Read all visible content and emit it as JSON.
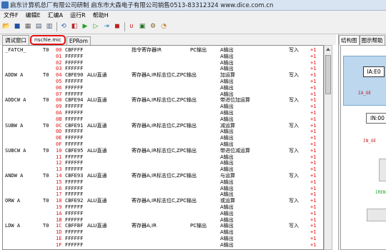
{
  "window": {
    "title": "启东计算机总厂有限公司研制  启东市大森电子有限公司销售0513-83312324 www.dice.com.cn"
  },
  "menu": [
    "文件F",
    "编辑E",
    "汇编A",
    "运行R",
    "帮助H"
  ],
  "toolbar": {
    "buttons": [
      {
        "name": "open-icon",
        "glyph": "📂",
        "color": "#c8a000"
      },
      {
        "name": "save-icon",
        "glyph": "■",
        "color": "#2050a0"
      },
      {
        "name": "compile-icon",
        "glyph": "▦",
        "color": "#606060"
      },
      {
        "name": "download-icon",
        "glyph": "▤",
        "color": "#506080"
      },
      {
        "name": "upload-icon",
        "glyph": "▥",
        "color": "#506080"
      },
      {
        "name": "reset-icon",
        "glyph": "⟲",
        "color": "#3060c0"
      },
      {
        "name": "step-back-icon",
        "glyph": "◧",
        "color": "#c02020"
      },
      {
        "name": "run-icon",
        "glyph": "▶",
        "color": "#20a020"
      },
      {
        "name": "step-icon",
        "glyph": "▷",
        "color": "#20a020"
      },
      {
        "name": "micro-step-icon",
        "glyph": "⇥",
        "color": "#2080c0"
      },
      {
        "name": "stop-icon",
        "glyph": "◼",
        "color": "#c02020"
      },
      {
        "name": "u-icon",
        "glyph": "υ",
        "color": "#c02020"
      },
      {
        "name": "table-icon",
        "glyph": "▣",
        "color": "#207020"
      },
      {
        "name": "settings-icon",
        "glyph": "⚙",
        "color": "#806020"
      },
      {
        "name": "help-icon",
        "glyph": "◔",
        "color": "#c08020"
      }
    ]
  },
  "tabs": [
    "调试窗口",
    "rischle.mic",
    "EPRom"
  ],
  "right_tabs": [
    "结构图",
    "图示帮助"
  ],
  "diagram": {
    "ia_label": "IA:E0",
    "ia_signal": "IA_OE",
    "in_label": "IN:00",
    "in_signal": "IN_OE",
    "bus_signal": "IREN"
  },
  "listing": [
    {
      "label": "_FATCH_",
      "t0": "T0",
      "addr": "00",
      "code": "CBFFFF",
      "desc": "",
      "regs": "指令寄存器IR",
      "extra": "PC输出",
      "a": "A输出",
      "wr": "写入",
      "plus": "+1"
    },
    {
      "label": "",
      "t0": "",
      "addr": "01",
      "code": "FFFFFF",
      "desc": "",
      "regs": "",
      "extra": "",
      "a": "A输出",
      "wr": "",
      "plus": "+1"
    },
    {
      "label": "",
      "t0": "",
      "addr": "02",
      "code": "FFFFFF",
      "desc": "",
      "regs": "",
      "extra": "",
      "a": "A输出",
      "wr": "",
      "plus": "+1"
    },
    {
      "label": "",
      "t0": "",
      "addr": "03",
      "code": "FFFFFF",
      "desc": "",
      "regs": "",
      "extra": "",
      "a": "A输出",
      "wr": "",
      "plus": "+1"
    },
    {
      "label": "ADDW A",
      "t0": "T0",
      "addr": "04",
      "code": "CBFE90",
      "desc": "ALU直通",
      "regs": "寄存器A,IR标志位C,ZPC输出",
      "extra": "",
      "a": "加运算",
      "wr": "写入",
      "plus": "+1"
    },
    {
      "label": "",
      "t0": "",
      "addr": "05",
      "code": "FFFFFF",
      "desc": "",
      "regs": "",
      "extra": "",
      "a": "A输出",
      "wr": "",
      "plus": "+1"
    },
    {
      "label": "",
      "t0": "",
      "addr": "06",
      "code": "FFFFFF",
      "desc": "",
      "regs": "",
      "extra": "",
      "a": "A输出",
      "wr": "",
      "plus": "+1"
    },
    {
      "label": "",
      "t0": "",
      "addr": "07",
      "code": "FFFFFF",
      "desc": "",
      "regs": "",
      "extra": "",
      "a": "A输出",
      "wr": "",
      "plus": "+1"
    },
    {
      "label": "ADDCW A",
      "t0": "T0",
      "addr": "08",
      "code": "CBFE94",
      "desc": "ALU直通",
      "regs": "寄存器A,IR标志位C,ZPC输出",
      "extra": "",
      "a": "带进位加运算",
      "wr": "写入",
      "plus": "+1"
    },
    {
      "label": "",
      "t0": "",
      "addr": "09",
      "code": "FFFFFF",
      "desc": "",
      "regs": "",
      "extra": "",
      "a": "A输出",
      "wr": "",
      "plus": "+1"
    },
    {
      "label": "",
      "t0": "",
      "addr": "0A",
      "code": "FFFFFF",
      "desc": "",
      "regs": "",
      "extra": "",
      "a": "A输出",
      "wr": "",
      "plus": "+1"
    },
    {
      "label": "",
      "t0": "",
      "addr": "0B",
      "code": "FFFFFF",
      "desc": "",
      "regs": "",
      "extra": "",
      "a": "A输出",
      "wr": "",
      "plus": "+1"
    },
    {
      "label": "SUBW A",
      "t0": "T0",
      "addr": "0C",
      "code": "CBFE91",
      "desc": "ALU直通",
      "regs": "寄存器A,IR标志位C,ZPC输出",
      "extra": "",
      "a": "减运算",
      "wr": "写入",
      "plus": "+1"
    },
    {
      "label": "",
      "t0": "",
      "addr": "0D",
      "code": "FFFFFF",
      "desc": "",
      "regs": "",
      "extra": "",
      "a": "A输出",
      "wr": "",
      "plus": "+1"
    },
    {
      "label": "",
      "t0": "",
      "addr": "0E",
      "code": "FFFFFF",
      "desc": "",
      "regs": "",
      "extra": "",
      "a": "A输出",
      "wr": "",
      "plus": "+1"
    },
    {
      "label": "",
      "t0": "",
      "addr": "0F",
      "code": "FFFFFF",
      "desc": "",
      "regs": "",
      "extra": "",
      "a": "A输出",
      "wr": "",
      "plus": "+1"
    },
    {
      "label": "SUBCW A",
      "t0": "T0",
      "addr": "10",
      "code": "CBFE95",
      "desc": "ALU直通",
      "regs": "寄存器A,IR标志位C,ZPC输出",
      "extra": "",
      "a": "带进位减运算",
      "wr": "写入",
      "plus": "+1"
    },
    {
      "label": "",
      "t0": "",
      "addr": "11",
      "code": "FFFFFF",
      "desc": "",
      "regs": "",
      "extra": "",
      "a": "A输出",
      "wr": "",
      "plus": "+1"
    },
    {
      "label": "",
      "t0": "",
      "addr": "12",
      "code": "FFFFFF",
      "desc": "",
      "regs": "",
      "extra": "",
      "a": "A输出",
      "wr": "",
      "plus": "+1"
    },
    {
      "label": "",
      "t0": "",
      "addr": "13",
      "code": "FFFFFF",
      "desc": "",
      "regs": "",
      "extra": "",
      "a": "A输出",
      "wr": "",
      "plus": "+1"
    },
    {
      "label": "ANDW A",
      "t0": "T0",
      "addr": "14",
      "code": "CBFE93",
      "desc": "ALU直通",
      "regs": "寄存器A,IR标志位C,ZPC输出",
      "extra": "",
      "a": "与运算",
      "wr": "写入",
      "plus": "+1"
    },
    {
      "label": "",
      "t0": "",
      "addr": "15",
      "code": "FFFFFF",
      "desc": "",
      "regs": "",
      "extra": "",
      "a": "A输出",
      "wr": "",
      "plus": "+1"
    },
    {
      "label": "",
      "t0": "",
      "addr": "16",
      "code": "FFFFFF",
      "desc": "",
      "regs": "",
      "extra": "",
      "a": "A输出",
      "wr": "",
      "plus": "+1"
    },
    {
      "label": "",
      "t0": "",
      "addr": "17",
      "code": "FFFFFF",
      "desc": "",
      "regs": "",
      "extra": "",
      "a": "A输出",
      "wr": "",
      "plus": "+1"
    },
    {
      "label": "ORW A",
      "t0": "T0",
      "addr": "18",
      "code": "CBFE92",
      "desc": "ALU直通",
      "regs": "寄存器A,IR标志位C,ZPC输出",
      "extra": "",
      "a": "或运算",
      "wr": "写入",
      "plus": "+1"
    },
    {
      "label": "",
      "t0": "",
      "addr": "19",
      "code": "FFFFFF",
      "desc": "",
      "regs": "",
      "extra": "",
      "a": "A输出",
      "wr": "",
      "plus": "+1"
    },
    {
      "label": "",
      "t0": "",
      "addr": "1A",
      "code": "FFFFFF",
      "desc": "",
      "regs": "",
      "extra": "",
      "a": "A输出",
      "wr": "",
      "plus": "+1"
    },
    {
      "label": "",
      "t0": "",
      "addr": "1B",
      "code": "FFFFFF",
      "desc": "",
      "regs": "",
      "extra": "",
      "a": "A输出",
      "wr": "",
      "plus": "+1"
    },
    {
      "label": "LDW A",
      "t0": "T0",
      "addr": "1C",
      "code": "CBFFBF",
      "desc": "ALU直通",
      "regs": "寄存器A,IR",
      "extra": "PC输出",
      "a": "A输出",
      "wr": "写入",
      "plus": "+1"
    },
    {
      "label": "",
      "t0": "",
      "addr": "1D",
      "code": "FFFFFF",
      "desc": "",
      "regs": "",
      "extra": "",
      "a": "A输出",
      "wr": "",
      "plus": "+1"
    },
    {
      "label": "",
      "t0": "",
      "addr": "1E",
      "code": "FFFFFF",
      "desc": "",
      "regs": "",
      "extra": "",
      "a": "A输出",
      "wr": "",
      "plus": "+1"
    },
    {
      "label": "",
      "t0": "",
      "addr": "1F",
      "code": "FFFFFF",
      "desc": "",
      "regs": "",
      "extra": "",
      "a": "A输出",
      "wr": "",
      "plus": "+1"
    }
  ]
}
